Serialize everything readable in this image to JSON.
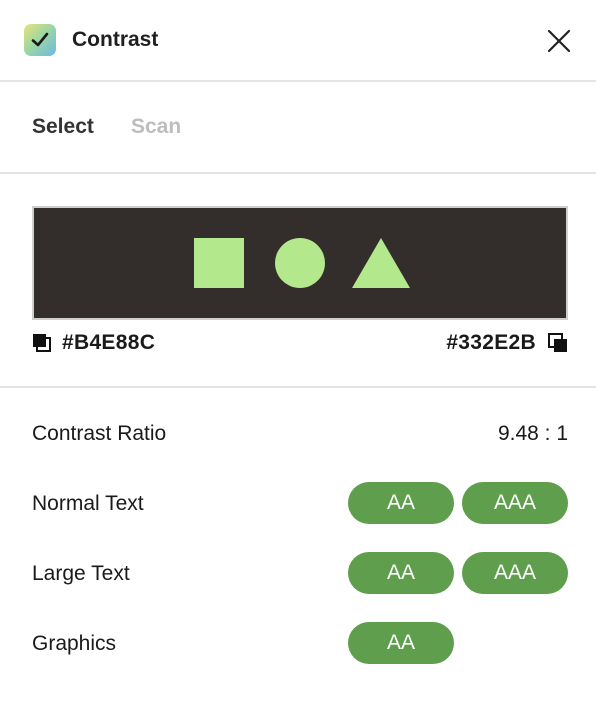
{
  "header": {
    "title": "Contrast",
    "app_icon": "check-badge-icon",
    "close_icon": "close-icon"
  },
  "tabs": [
    {
      "label": "Select",
      "active": true
    },
    {
      "label": "Scan",
      "active": false
    }
  ],
  "preview": {
    "background_color": "#332E2B",
    "foreground_color": "#B4E88C",
    "shapes": [
      "square",
      "circle",
      "triangle"
    ]
  },
  "colors": {
    "foreground_hex": "#B4E88C",
    "background_hex": "#332E2B",
    "pass_color": "#5E9E4C"
  },
  "results": {
    "ratio_label": "Contrast Ratio",
    "ratio_value": "9.48 : 1",
    "rows": [
      {
        "label": "Normal Text",
        "badges": [
          "AA",
          "AAA"
        ]
      },
      {
        "label": "Large Text",
        "badges": [
          "AA",
          "AAA"
        ]
      },
      {
        "label": "Graphics",
        "badges": [
          "AA"
        ]
      }
    ]
  }
}
